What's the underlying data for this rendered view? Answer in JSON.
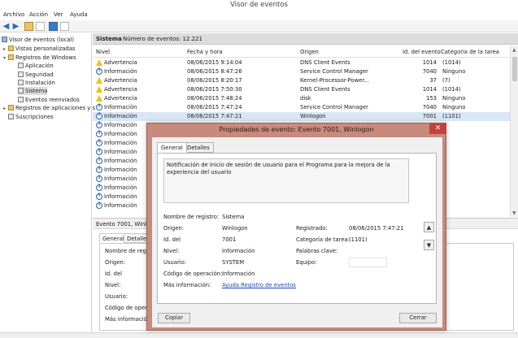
{
  "window": {
    "title": "Visor de eventos"
  },
  "menu": {
    "items": [
      "Archivo",
      "Acción",
      "Ver",
      "Ayuda"
    ]
  },
  "tree": {
    "items": [
      {
        "label": "Visor de eventos (local)"
      },
      {
        "label": "Vistas personalizadas"
      },
      {
        "label": "Registros de Windows"
      },
      {
        "label": "Aplicación"
      },
      {
        "label": "Seguridad"
      },
      {
        "label": "Instalación"
      },
      {
        "label": "Sistema"
      },
      {
        "label": "Eventos reenviados"
      },
      {
        "label": "Registros de aplicaciones y s"
      },
      {
        "label": "Suscripciones"
      }
    ]
  },
  "center": {
    "title": "Sistema",
    "count_label": "Número de eventos: 12.221"
  },
  "columns": {
    "nivel": "Nivel",
    "fecha": "Fecha y hora",
    "origen": "Origen",
    "id": "Id. del evento",
    "categoria": "Categoría de la tarea"
  },
  "rows": [
    {
      "icon": "warning-icon",
      "nivel": "Advertencia",
      "fecha": "08/06/2015 9:14:04",
      "origen": "DNS Client Events",
      "id": "1014",
      "cat": "(1014)"
    },
    {
      "icon": "info-icon",
      "nivel": "Información",
      "fecha": "08/06/2015 8:47:26",
      "origen": "Service Control Manager",
      "id": "7040",
      "cat": "Ninguno"
    },
    {
      "icon": "warning-icon",
      "nivel": "Advertencia",
      "fecha": "08/06/2015 8:20:17",
      "origen": "Kernel-Processor-Power...",
      "id": "37",
      "cat": "(7)"
    },
    {
      "icon": "warning-icon",
      "nivel": "Advertencia",
      "fecha": "08/06/2015 7:50:30",
      "origen": "DNS Client Events",
      "id": "1014",
      "cat": "(1014)"
    },
    {
      "icon": "warning-icon",
      "nivel": "Advertencia",
      "fecha": "08/06/2015 7:48:24",
      "origen": "disk",
      "id": "153",
      "cat": "Ninguno"
    },
    {
      "icon": "info-icon",
      "nivel": "Información",
      "fecha": "08/06/2015 7:47:24",
      "origen": "Service Control Manager",
      "id": "7040",
      "cat": "Ninguno"
    },
    {
      "icon": "info-icon",
      "nivel": "Información",
      "fecha": "08/06/2015 7:47:21",
      "origen": "Winlogon",
      "id": "7001",
      "cat": "(1101)"
    },
    {
      "icon": "info-icon",
      "nivel": "Información",
      "fecha": "",
      "origen": "",
      "id": "",
      "cat": ""
    },
    {
      "icon": "info-icon",
      "nivel": "Información",
      "fecha": "",
      "origen": "",
      "id": "",
      "cat": ""
    },
    {
      "icon": "info-icon",
      "nivel": "Información",
      "fecha": "",
      "origen": "",
      "id": "",
      "cat": ""
    },
    {
      "icon": "info-icon",
      "nivel": "Información",
      "fecha": "",
      "origen": "",
      "id": "",
      "cat": ""
    },
    {
      "icon": "info-icon",
      "nivel": "Información",
      "fecha": "",
      "origen": "",
      "id": "",
      "cat": ""
    },
    {
      "icon": "info-icon",
      "nivel": "Información",
      "fecha": "",
      "origen": "",
      "id": "",
      "cat": ""
    },
    {
      "icon": "info-icon",
      "nivel": "Información",
      "fecha": "",
      "origen": "",
      "id": "",
      "cat": ""
    },
    {
      "icon": "info-icon",
      "nivel": "Información",
      "fecha": "",
      "origen": "",
      "id": "",
      "cat": ""
    },
    {
      "icon": "info-icon",
      "nivel": "Información",
      "fecha": "",
      "origen": "",
      "id": "",
      "cat": ""
    },
    {
      "icon": "info-icon",
      "nivel": "Información",
      "fecha": "",
      "origen": "",
      "id": "",
      "cat": ""
    }
  ],
  "lower": {
    "header": "Evento 7001, Winlog",
    "tabs": [
      "General",
      "Detalles"
    ],
    "labels": [
      "Nombre de regist",
      "Origen:",
      "Id. del",
      "Nivel:",
      "Usuario:",
      "Código de operac",
      "Más informació"
    ]
  },
  "dialog": {
    "title": "Propiedades de evento: Evento 7001, Winlogon",
    "close_glyph": "✕",
    "tabs": [
      "General",
      "Detalles"
    ],
    "message": "Notificación de inicio de sesión de usuario para el Programa para la mejora de la experiencia del usuario",
    "fields": {
      "log_name_label": "Nombre de registro:",
      "log_name_value": "Sistema",
      "source_label": "Origen:",
      "source_value": "Winlogon",
      "logged_label": "Registrado:",
      "logged_value": "08/06/2015 7:47:21",
      "id_label": "Id. del",
      "id_value": "7001",
      "task_label": "Categoría de tarea:",
      "task_value": "(1101)",
      "level_label": "Nivel:",
      "level_value": "Información",
      "keywords_label": "Palabras clave:",
      "user_label": "Usuario:",
      "user_value": "SYSTEM",
      "computer_label": "Equipo:",
      "opcode_label": "Código de operación:",
      "opcode_value": "Información",
      "more_label": "Más información:",
      "more_link": "Ayuda Registro de eventos"
    },
    "copy_button": "Copiar",
    "close_button": "Cerrar"
  },
  "colors": {
    "dialog_frame": "#c78a7c",
    "selection": "#d8e6f5",
    "link": "#1a49b6",
    "warning": "#f2c200"
  }
}
